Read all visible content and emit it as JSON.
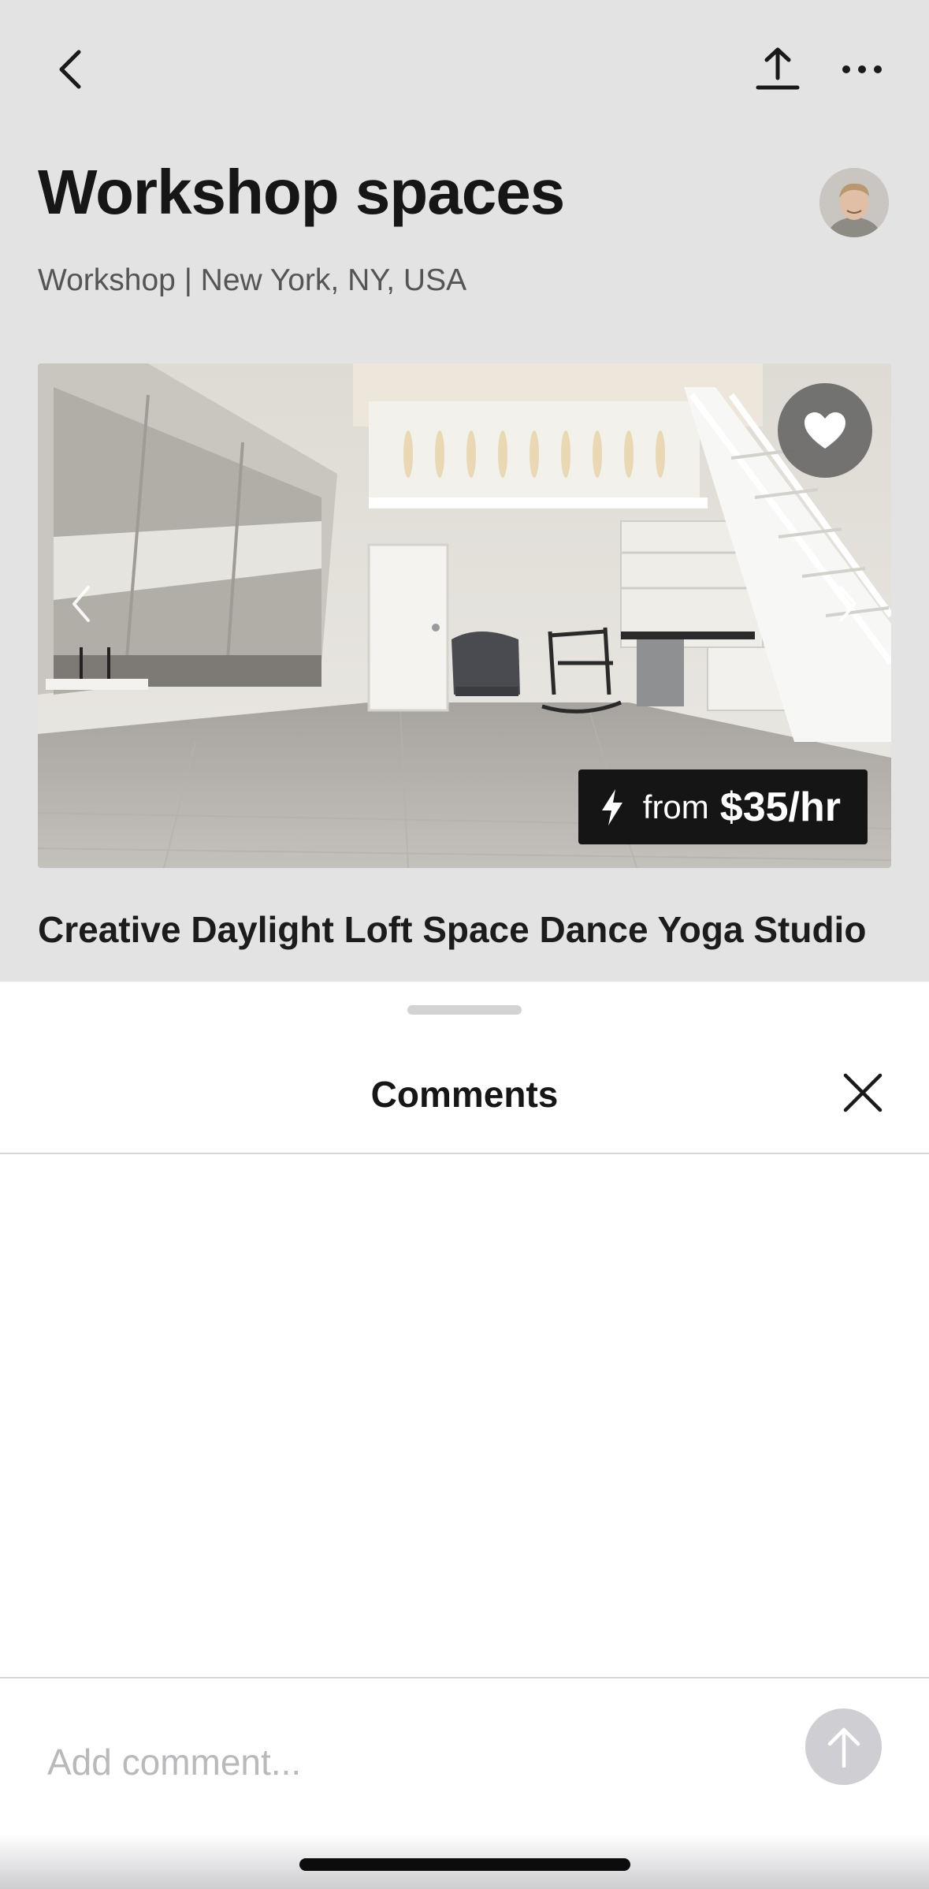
{
  "header": {
    "title": "Workshop spaces",
    "subtitle": "Workshop | New York, NY, USA",
    "icons": {
      "back": "chevron-left-icon",
      "share": "share-upload-icon",
      "more": "ellipsis-icon",
      "avatar": "user-avatar"
    }
  },
  "listing": {
    "title": "Creative Daylight Loft Space Dance Yoga Studio",
    "price_from_label": "from",
    "price": "$35/hr",
    "favorite_icon": "heart-icon",
    "instant_icon": "lightning-bolt-icon"
  },
  "comments_sheet": {
    "title": "Comments",
    "input_placeholder": "Add comment...",
    "comments": [],
    "icons": {
      "close": "close-icon",
      "send": "arrow-up-icon"
    }
  },
  "colors": {
    "dimmed_background": "#e3e3e4",
    "sheet_background": "#ffffff",
    "badge_background": "#151515",
    "send_button_disabled": "#cfcfd3"
  }
}
